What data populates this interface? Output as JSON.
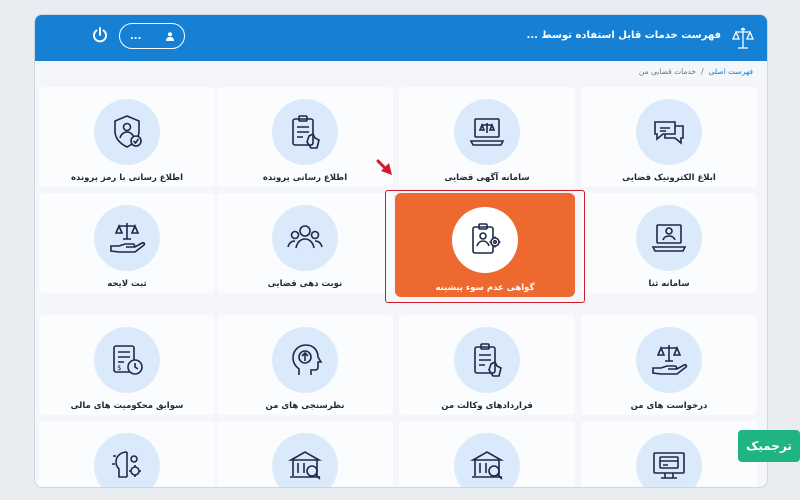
{
  "header": {
    "title": "فهرست خدمات قابل استفاده توسط ...",
    "user_label": "...",
    "logo_icon": "scales-emblem-icon",
    "power_icon": "power-icon"
  },
  "breadcrumb": {
    "home": "فهرست اصلی",
    "separator": "/",
    "current": "خدمات قضایی من"
  },
  "services": [
    {
      "label": "ابلاغ الکترونیک قضایی",
      "icon": "chat-bubbles-icon"
    },
    {
      "label": "سامانه آگهی قضایی",
      "icon": "laptop-scales-icon"
    },
    {
      "label": "اطلاع رسانی پرونده",
      "icon": "clipboard-hand-icon"
    },
    {
      "label": "اطلاع رسانی با رمز پرونده",
      "icon": "shield-user-icon"
    },
    {
      "label": "سامانه ثنا",
      "icon": "laptop-user-icon"
    },
    {
      "label": "گواهی عدم سوء پیشینه",
      "icon": "clipboard-user-gear-icon",
      "active": true
    },
    {
      "label": "نوبت دهی قضایی",
      "icon": "people-group-icon"
    },
    {
      "label": "ثبت لایحه",
      "icon": "hand-scales-icon"
    },
    {
      "label": "درخواست های من",
      "icon": "hand-scales-icon"
    },
    {
      "label": "قراردادهای وکالت من",
      "icon": "clipboard-hand-icon"
    },
    {
      "label": "نظرسنجی های من",
      "icon": "head-arrow-icon"
    },
    {
      "label": "سوابق محکومیت های مالی",
      "icon": "document-clock-icon"
    },
    {
      "label": "",
      "icon": "monitor-card-icon"
    },
    {
      "label": "",
      "icon": "building-search-icon"
    },
    {
      "label": "",
      "icon": "building-search-icon"
    },
    {
      "label": "",
      "icon": "brain-gears-icon"
    }
  ],
  "badge": {
    "text": "ترجمیک"
  },
  "colors": {
    "header_blue": "#1580d4",
    "active_orange": "#ee6930",
    "highlight_red": "#d31a2a",
    "icon_circle": "#dbeafb",
    "badge_green": "#20b481"
  }
}
